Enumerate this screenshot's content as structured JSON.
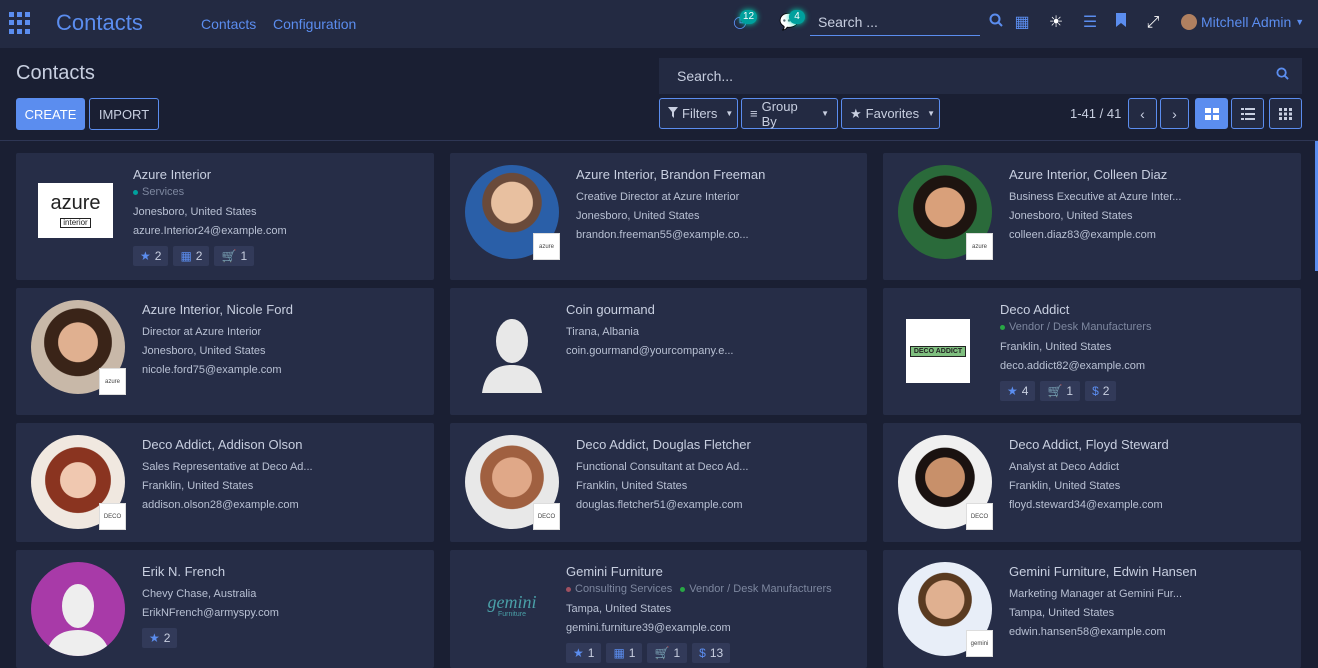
{
  "app_title": "Contacts",
  "top_menu": [
    "Contacts",
    "Configuration"
  ],
  "systray": {
    "activity_count": "12",
    "messages_count": "4",
    "search_placeholder": "Search ...",
    "user_name": "Mitchell Admin"
  },
  "breadcrumb": "Contacts",
  "buttons": {
    "create": "CREATE",
    "import": "IMPORT"
  },
  "search": {
    "placeholder": "Search..."
  },
  "filters": {
    "filters": "Filters",
    "group_by": "Group By",
    "favorites": "Favorites"
  },
  "pager": {
    "value": "1-41 / 41"
  },
  "colors": {
    "accent": "#5b8def",
    "bg": "#1a1f33",
    "card": "#262d47",
    "badge": "#00a09d"
  },
  "cards": [
    {
      "name": "Azure Interior",
      "tags": [
        {
          "label": "Services",
          "color": "#00a09d"
        }
      ],
      "lines": [
        "Jonesboro, United States",
        "azure.Interior24@example.com"
      ],
      "chips": [
        {
          "icon": "star-icon",
          "value": "2"
        },
        {
          "icon": "calendar-icon",
          "value": "2"
        },
        {
          "icon": "cart-icon",
          "value": "1"
        }
      ],
      "logo_text": "azure",
      "logo_sub": "interior"
    },
    {
      "name": "Azure Interior, Brandon Freeman",
      "tags": [],
      "lines": [
        "Creative Director at Azure Interior",
        "Jonesboro, United States",
        "brandon.freeman55@example.co..."
      ],
      "chips": [],
      "mini": "azure"
    },
    {
      "name": "Azure Interior, Colleen Diaz",
      "tags": [],
      "lines": [
        "Business Executive at Azure Inter...",
        "Jonesboro, United States",
        "colleen.diaz83@example.com"
      ],
      "chips": [],
      "mini": "azure"
    },
    {
      "name": "Azure Interior, Nicole Ford",
      "tags": [],
      "lines": [
        "Director at Azure Interior",
        "Jonesboro, United States",
        "nicole.ford75@example.com"
      ],
      "chips": [],
      "mini": "azure"
    },
    {
      "name": "Coin gourmand",
      "tags": [],
      "lines": [
        "Tirana, Albania",
        "coin.gourmand@yourcompany.e..."
      ],
      "chips": []
    },
    {
      "name": "Deco Addict",
      "tags": [
        {
          "label": "Vendor / Desk Manufacturers",
          "color": "#28a745"
        }
      ],
      "lines": [
        "Franklin, United States",
        "deco.addict82@example.com"
      ],
      "chips": [
        {
          "icon": "star-icon",
          "value": "4"
        },
        {
          "icon": "cart-icon",
          "value": "1"
        },
        {
          "icon": "dollar-icon",
          "value": "2"
        }
      ],
      "logo_text": "DECO ADDICT"
    },
    {
      "name": "Deco Addict, Addison Olson",
      "tags": [],
      "lines": [
        "Sales Representative at Deco Ad...",
        "Franklin, United States",
        "addison.olson28@example.com"
      ],
      "chips": [],
      "mini": "DECO"
    },
    {
      "name": "Deco Addict, Douglas Fletcher",
      "tags": [],
      "lines": [
        "Functional Consultant at Deco Ad...",
        "Franklin, United States",
        "douglas.fletcher51@example.com"
      ],
      "chips": [],
      "mini": "DECO"
    },
    {
      "name": "Deco Addict, Floyd Steward",
      "tags": [],
      "lines": [
        "Analyst at Deco Addict",
        "Franklin, United States",
        "floyd.steward34@example.com"
      ],
      "chips": [],
      "mini": "DECO"
    },
    {
      "name": "Erik N. French",
      "tags": [],
      "lines": [
        "Chevy Chase, Australia",
        "ErikNFrench@armyspy.com"
      ],
      "chips": [
        {
          "icon": "star-icon",
          "value": "2"
        }
      ]
    },
    {
      "name": "Gemini Furniture",
      "tags": [
        {
          "label": "Consulting Services",
          "color": "#a05060"
        },
        {
          "label": "Vendor / Desk Manufacturers",
          "color": "#28a745"
        }
      ],
      "lines": [
        "Tampa, United States",
        "gemini.furniture39@example.com"
      ],
      "chips": [
        {
          "icon": "star-icon",
          "value": "1"
        },
        {
          "icon": "calendar-icon",
          "value": "1"
        },
        {
          "icon": "cart-icon",
          "value": "1"
        },
        {
          "icon": "dollar-icon",
          "value": "13"
        }
      ],
      "logo_text": "gemini",
      "logo_sub": "Furniture"
    },
    {
      "name": "Gemini Furniture, Edwin Hansen",
      "tags": [],
      "lines": [
        "Marketing Manager at Gemini Fur...",
        "Tampa, United States",
        "edwin.hansen58@example.com"
      ],
      "chips": [],
      "mini": "gemini"
    }
  ]
}
